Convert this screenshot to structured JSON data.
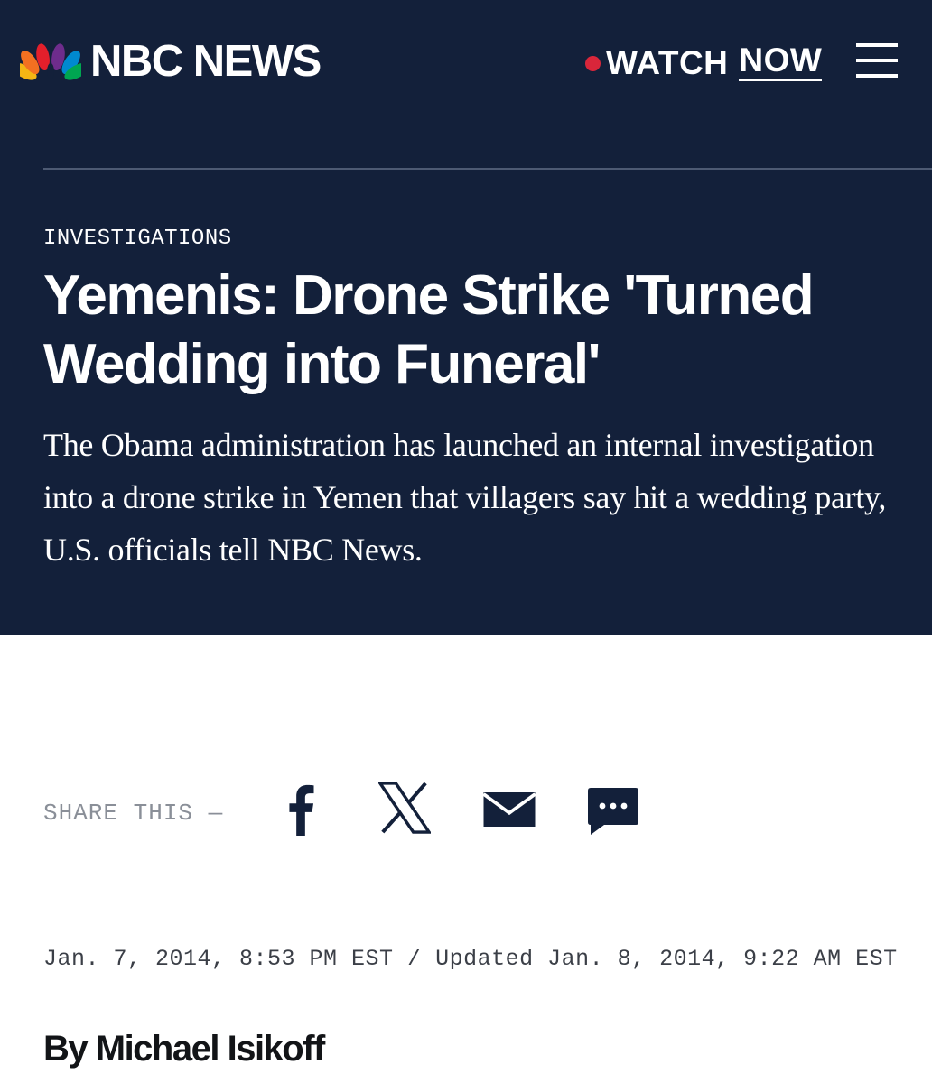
{
  "header": {
    "brand": "NBC NEWS",
    "watch_label": "WATCH",
    "watch_now": "NOW",
    "colors": {
      "background": "#13203a",
      "live_dot": "#d9263a"
    },
    "icons": {
      "logo": "nbc-peacock-icon",
      "menu": "hamburger-menu-icon"
    }
  },
  "article": {
    "section": "INVESTIGATIONS",
    "headline": "Yemenis: Drone Strike 'Turned Wedding into Funeral'",
    "dek": "The Obama administration has launched an internal investigation into a drone strike in Yemen that villagers say hit a wedding party, U.S. officials tell NBC News.",
    "timestamp": "Jan. 7, 2014, 8:53 PM EST / Updated Jan. 8, 2014, 9:22 AM EST",
    "byline": "By Michael Isikoff"
  },
  "share": {
    "label": "SHARE THIS —",
    "icons": [
      "facebook-icon",
      "x-twitter-icon",
      "email-icon",
      "comments-icon"
    ]
  }
}
